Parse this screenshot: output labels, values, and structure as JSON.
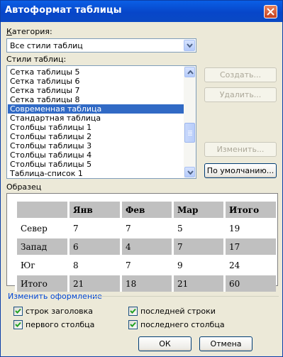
{
  "dialog": {
    "title": "Автоформат таблицы"
  },
  "category": {
    "label_prefix": "К",
    "label_rest": "атегория:",
    "selected": "Все стили таблиц"
  },
  "styles": {
    "label": "Стили таблиц:",
    "items": [
      {
        "label": "Сетка таблицы 5"
      },
      {
        "label": "Сетка таблицы 6"
      },
      {
        "label": "Сетка таблицы 7"
      },
      {
        "label": "Сетка таблицы 8"
      },
      {
        "label": "Современная таблица",
        "selected": true
      },
      {
        "label": "Стандартная таблица"
      },
      {
        "label": "Столбцы таблицы 1"
      },
      {
        "label": "Столбцы таблицы 2"
      },
      {
        "label": "Столбцы таблицы 3"
      },
      {
        "label": "Столбцы таблицы 4"
      },
      {
        "label": "Столбцы таблицы 5"
      },
      {
        "label": "Таблица-список 1"
      }
    ]
  },
  "buttons": {
    "create": "Создать...",
    "delete": "Удалить...",
    "modify": "Изменить...",
    "default": "По умолчанию...",
    "ok": "ОК",
    "cancel": "Отмена"
  },
  "preview": {
    "label": "Образец",
    "header": [
      "",
      "Янв",
      "Фев",
      "Мар",
      "Итого"
    ],
    "rows": [
      [
        "Север",
        "7",
        "7",
        "5",
        "19"
      ],
      [
        "Запад",
        "6",
        "4",
        "7",
        "17"
      ],
      [
        "Юг",
        "8",
        "7",
        "9",
        "24"
      ],
      [
        "Итого",
        "21",
        "18",
        "21",
        "60"
      ]
    ]
  },
  "apply": {
    "label": "Изменить оформление",
    "options": [
      {
        "label": "строк заголовка",
        "checked": true
      },
      {
        "label": "последней строки",
        "checked": true
      },
      {
        "label": "первого столбца",
        "checked": true
      },
      {
        "label": "последнего столбца",
        "checked": true
      }
    ]
  }
}
